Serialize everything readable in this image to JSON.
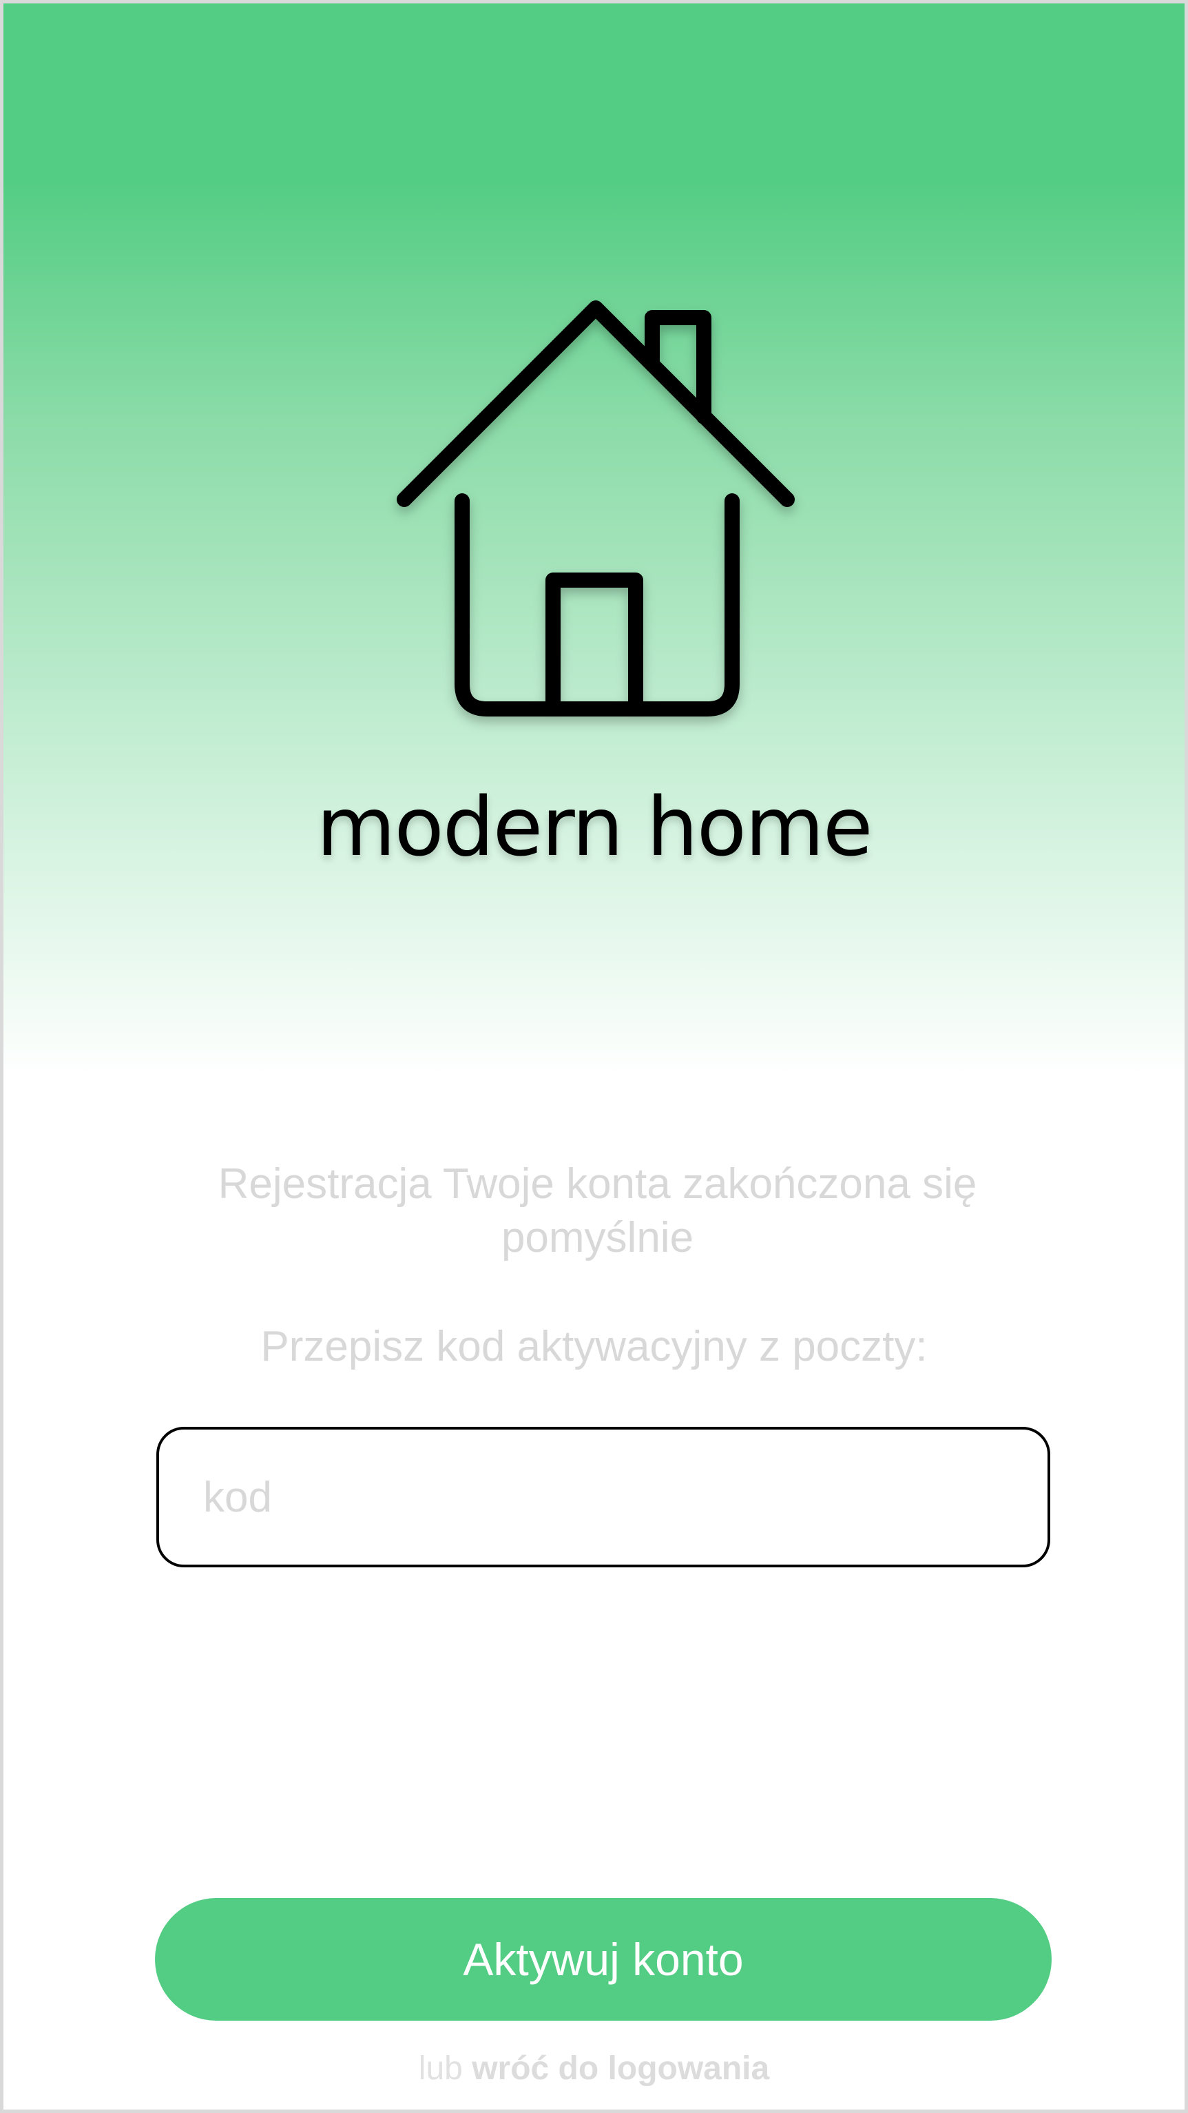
{
  "app": {
    "brand_name": "modern home",
    "brand_color": "#54cd84",
    "logo_icon": "house-icon"
  },
  "activation": {
    "message": "Rejestracja Twoje konta zakończona się pomyślnie",
    "instruction": "Przepisz kod aktywacyjny z poczty:",
    "code_value": "",
    "code_placeholder": "kod",
    "activate_label": "Aktywuj konto",
    "footer_prefix": "lub",
    "back_link_label": "wróć do logowania"
  }
}
